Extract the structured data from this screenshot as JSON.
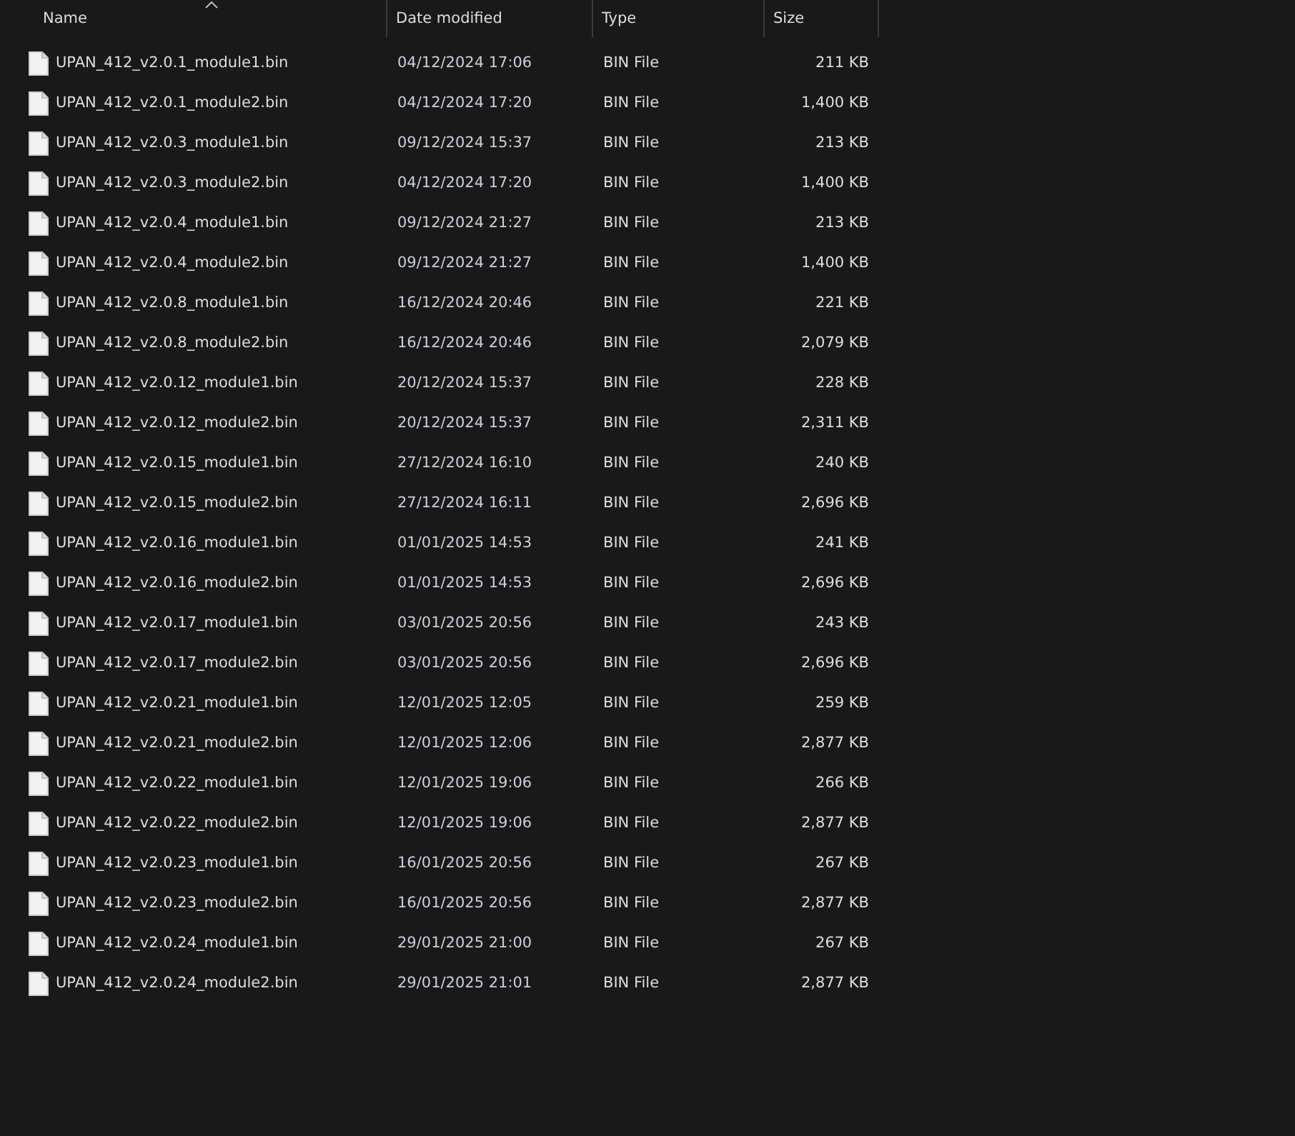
{
  "table": {
    "columns": [
      {
        "label": "Name",
        "sorted": true
      },
      {
        "label": "Date modified",
        "sorted": false
      },
      {
        "label": "Type",
        "sorted": false
      },
      {
        "label": "Size",
        "sorted": false
      }
    ],
    "rows": [
      {
        "name": "UPAN_412_v2.0.1_module1.bin",
        "date": "04/12/2024 17:06",
        "type": "BIN File",
        "size": "211 KB"
      },
      {
        "name": "UPAN_412_v2.0.1_module2.bin",
        "date": "04/12/2024 17:20",
        "type": "BIN File",
        "size": "1,400 KB"
      },
      {
        "name": "UPAN_412_v2.0.3_module1.bin",
        "date": "09/12/2024 15:37",
        "type": "BIN File",
        "size": "213 KB"
      },
      {
        "name": "UPAN_412_v2.0.3_module2.bin",
        "date": "04/12/2024 17:20",
        "type": "BIN File",
        "size": "1,400 KB"
      },
      {
        "name": "UPAN_412_v2.0.4_module1.bin",
        "date": "09/12/2024 21:27",
        "type": "BIN File",
        "size": "213 KB"
      },
      {
        "name": "UPAN_412_v2.0.4_module2.bin",
        "date": "09/12/2024 21:27",
        "type": "BIN File",
        "size": "1,400 KB"
      },
      {
        "name": "UPAN_412_v2.0.8_module1.bin",
        "date": "16/12/2024 20:46",
        "type": "BIN File",
        "size": "221 KB"
      },
      {
        "name": "UPAN_412_v2.0.8_module2.bin",
        "date": "16/12/2024 20:46",
        "type": "BIN File",
        "size": "2,079 KB"
      },
      {
        "name": "UPAN_412_v2.0.12_module1.bin",
        "date": "20/12/2024 15:37",
        "type": "BIN File",
        "size": "228 KB"
      },
      {
        "name": "UPAN_412_v2.0.12_module2.bin",
        "date": "20/12/2024 15:37",
        "type": "BIN File",
        "size": "2,311 KB"
      },
      {
        "name": "UPAN_412_v2.0.15_module1.bin",
        "date": "27/12/2024 16:10",
        "type": "BIN File",
        "size": "240 KB"
      },
      {
        "name": "UPAN_412_v2.0.15_module2.bin",
        "date": "27/12/2024 16:11",
        "type": "BIN File",
        "size": "2,696 KB"
      },
      {
        "name": "UPAN_412_v2.0.16_module1.bin",
        "date": "01/01/2025 14:53",
        "type": "BIN File",
        "size": "241 KB"
      },
      {
        "name": "UPAN_412_v2.0.16_module2.bin",
        "date": "01/01/2025 14:53",
        "type": "BIN File",
        "size": "2,696 KB"
      },
      {
        "name": "UPAN_412_v2.0.17_module1.bin",
        "date": "03/01/2025 20:56",
        "type": "BIN File",
        "size": "243 KB"
      },
      {
        "name": "UPAN_412_v2.0.17_module2.bin",
        "date": "03/01/2025 20:56",
        "type": "BIN File",
        "size": "2,696 KB"
      },
      {
        "name": "UPAN_412_v2.0.21_module1.bin",
        "date": "12/01/2025 12:05",
        "type": "BIN File",
        "size": "259 KB"
      },
      {
        "name": "UPAN_412_v2.0.21_module2.bin",
        "date": "12/01/2025 12:06",
        "type": "BIN File",
        "size": "2,877 KB"
      },
      {
        "name": "UPAN_412_v2.0.22_module1.bin",
        "date": "12/01/2025 19:06",
        "type": "BIN File",
        "size": "266 KB"
      },
      {
        "name": "UPAN_412_v2.0.22_module2.bin",
        "date": "12/01/2025 19:06",
        "type": "BIN File",
        "size": "2,877 KB"
      },
      {
        "name": "UPAN_412_v2.0.23_module1.bin",
        "date": "16/01/2025 20:56",
        "type": "BIN File",
        "size": "267 KB"
      },
      {
        "name": "UPAN_412_v2.0.23_module2.bin",
        "date": "16/01/2025 20:56",
        "type": "BIN File",
        "size": "2,877 KB"
      },
      {
        "name": "UPAN_412_v2.0.24_module1.bin",
        "date": "29/01/2025 21:00",
        "type": "BIN File",
        "size": "267 KB"
      },
      {
        "name": "UPAN_412_v2.0.24_module2.bin",
        "date": "29/01/2025 21:01",
        "type": "BIN File",
        "size": "2,877 KB"
      }
    ]
  }
}
